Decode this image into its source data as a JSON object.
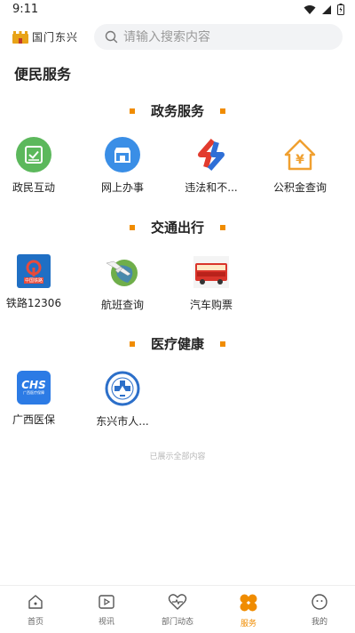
{
  "status": {
    "time": "9:11"
  },
  "header": {
    "logo_text": "国门东兴",
    "search_placeholder": "请输入搜索内容"
  },
  "page_title": "便民服务",
  "sections": [
    {
      "title": "政务服务",
      "items": [
        {
          "label": "政民互动",
          "icon": "chat-check-icon"
        },
        {
          "label": "网上办事",
          "icon": "storefront-icon"
        },
        {
          "label": "违法和不...",
          "icon": "report-arrows-icon"
        },
        {
          "label": "公积金查询",
          "icon": "house-yuan-icon"
        }
      ]
    },
    {
      "title": "交通出行",
      "items": [
        {
          "label": "铁路12306",
          "icon": "china-railway-icon",
          "badge": "中国铁路"
        },
        {
          "label": "航班查询",
          "icon": "airplane-globe-icon"
        },
        {
          "label": "汽车购票",
          "icon": "bus-icon"
        }
      ]
    },
    {
      "title": "医疗健康",
      "items": [
        {
          "label": "广西医保",
          "icon": "chs-medical-insurance-icon",
          "badge": "CHS",
          "sub": "广西医疗保障"
        },
        {
          "label": "东兴市人...",
          "icon": "hospital-emblem-icon"
        }
      ]
    }
  ],
  "end_note": "已展示全部内容",
  "tabbar": {
    "active": "服务",
    "items": [
      {
        "label": "首页",
        "icon": "home-icon"
      },
      {
        "label": "视讯",
        "icon": "video-icon"
      },
      {
        "label": "部门动态",
        "icon": "heart-pulse-icon"
      },
      {
        "label": "服务",
        "icon": "clover-icon"
      },
      {
        "label": "我的",
        "icon": "profile-face-icon"
      }
    ]
  },
  "colors": {
    "accent": "#f08c00",
    "green": "#5cb85c",
    "blue": "#3a8ee6",
    "red": "#e23b2e"
  }
}
